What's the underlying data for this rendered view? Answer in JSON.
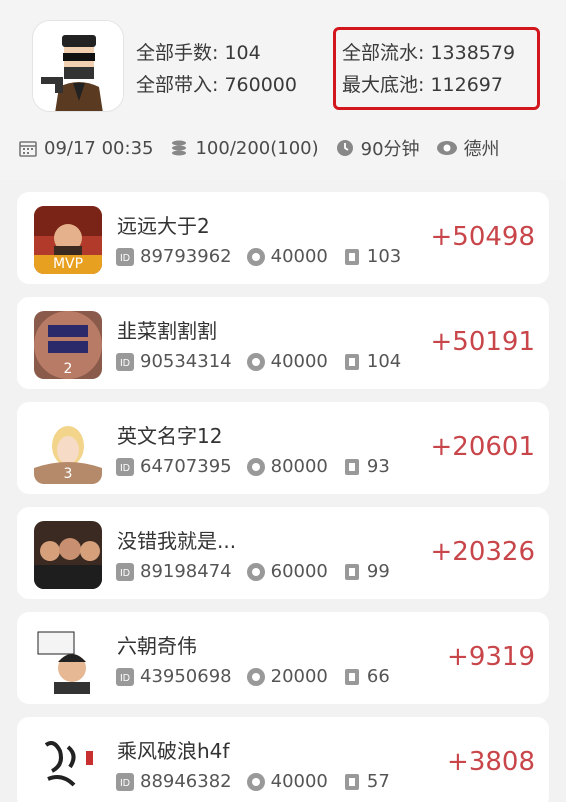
{
  "header": {
    "total_hands": "全部手数: 104",
    "total_buyin": "全部带入: 760000",
    "total_flow": "全部流水: 1338579",
    "max_pot": "最大底池: 112697",
    "highlight_color": "#d2161c"
  },
  "info": {
    "datetime": "09/17 00:35",
    "players": "100/200(100)",
    "duration": "90分钟",
    "game_type": "德州"
  },
  "players": [
    {
      "name": "远远大于2",
      "id": "89793962",
      "buyin": "40000",
      "hands": "103",
      "result": "+50498",
      "badge": "MVP"
    },
    {
      "name": "韭菜割割割",
      "id": "90534314",
      "buyin": "40000",
      "hands": "104",
      "result": "+50191",
      "badge": "2"
    },
    {
      "name": "英文名字12",
      "id": "64707395",
      "buyin": "80000",
      "hands": "93",
      "result": "+20601",
      "badge": "3"
    },
    {
      "name": "没错我就是...",
      "id": "89198474",
      "buyin": "60000",
      "hands": "99",
      "result": "+20326",
      "badge": ""
    },
    {
      "name": "六朝奇伟",
      "id": "43950698",
      "buyin": "20000",
      "hands": "66",
      "result": "+9319",
      "badge": ""
    },
    {
      "name": "乘风破浪h4f",
      "id": "88946382",
      "buyin": "40000",
      "hands": "57",
      "result": "+3808",
      "badge": ""
    }
  ],
  "colors": {
    "score": "#c8454a",
    "mvp": "#e8a020"
  }
}
